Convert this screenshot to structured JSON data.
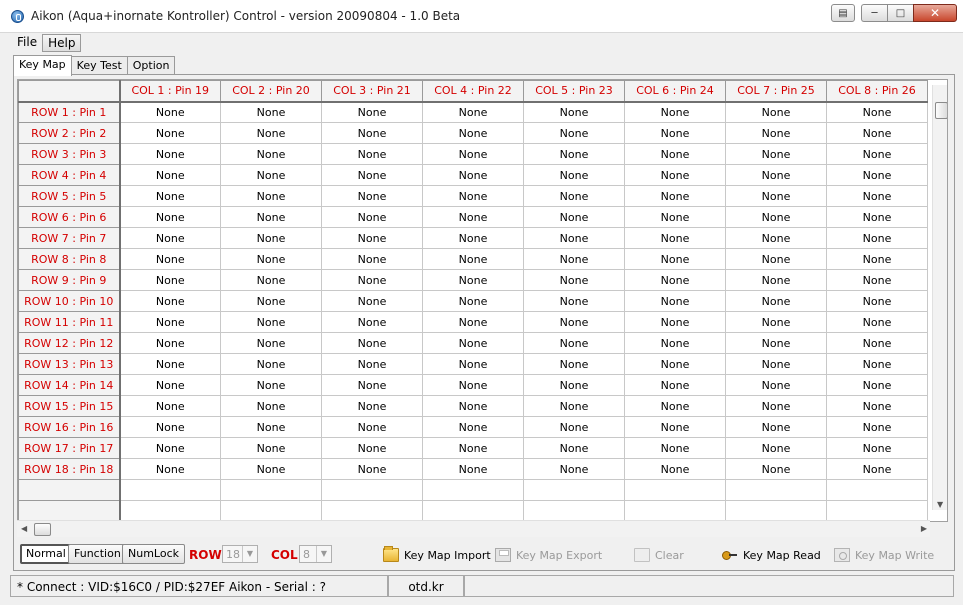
{
  "window": {
    "title": "Aikon (Aqua+inornate Kontroller) Control - version 20090804 - 1.0 Beta",
    "icons": [
      "app-icon",
      "restore-extra-icon",
      "minimize-icon",
      "maximize-icon",
      "close-icon"
    ]
  },
  "menu": {
    "items": [
      "File",
      "Help"
    ]
  },
  "tabs": [
    "Key Map",
    "Key Test",
    "Option"
  ],
  "grid": {
    "columns": [
      "COL 1 : Pin 19",
      "COL 2 : Pin 20",
      "COL 3 : Pin 21",
      "COL 4 : Pin 22",
      "COL 5 : Pin 23",
      "COL 6 : Pin 24",
      "COL 7 : Pin 25",
      "COL 8 : Pin 26"
    ],
    "rows": [
      {
        "label": "ROW 1 : Pin 1",
        "cells": [
          "None",
          "None",
          "None",
          "None",
          "None",
          "None",
          "None",
          "None"
        ]
      },
      {
        "label": "ROW 2 : Pin 2",
        "cells": [
          "None",
          "None",
          "None",
          "None",
          "None",
          "None",
          "None",
          "None"
        ]
      },
      {
        "label": "ROW 3 : Pin 3",
        "cells": [
          "None",
          "None",
          "None",
          "None",
          "None",
          "None",
          "None",
          "None"
        ]
      },
      {
        "label": "ROW 4 : Pin 4",
        "cells": [
          "None",
          "None",
          "None",
          "None",
          "None",
          "None",
          "None",
          "None"
        ]
      },
      {
        "label": "ROW 5 : Pin 5",
        "cells": [
          "None",
          "None",
          "None",
          "None",
          "None",
          "None",
          "None",
          "None"
        ]
      },
      {
        "label": "ROW 6 : Pin 6",
        "cells": [
          "None",
          "None",
          "None",
          "None",
          "None",
          "None",
          "None",
          "None"
        ]
      },
      {
        "label": "ROW 7 : Pin 7",
        "cells": [
          "None",
          "None",
          "None",
          "None",
          "None",
          "None",
          "None",
          "None"
        ]
      },
      {
        "label": "ROW 8 : Pin 8",
        "cells": [
          "None",
          "None",
          "None",
          "None",
          "None",
          "None",
          "None",
          "None"
        ]
      },
      {
        "label": "ROW 9 : Pin 9",
        "cells": [
          "None",
          "None",
          "None",
          "None",
          "None",
          "None",
          "None",
          "None"
        ]
      },
      {
        "label": "ROW 10 : Pin 10",
        "cells": [
          "None",
          "None",
          "None",
          "None",
          "None",
          "None",
          "None",
          "None"
        ]
      },
      {
        "label": "ROW 11 : Pin 11",
        "cells": [
          "None",
          "None",
          "None",
          "None",
          "None",
          "None",
          "None",
          "None"
        ]
      },
      {
        "label": "ROW 12 : Pin 12",
        "cells": [
          "None",
          "None",
          "None",
          "None",
          "None",
          "None",
          "None",
          "None"
        ]
      },
      {
        "label": "ROW 13 : Pin 13",
        "cells": [
          "None",
          "None",
          "None",
          "None",
          "None",
          "None",
          "None",
          "None"
        ]
      },
      {
        "label": "ROW 14 : Pin 14",
        "cells": [
          "None",
          "None",
          "None",
          "None",
          "None",
          "None",
          "None",
          "None"
        ]
      },
      {
        "label": "ROW 15 : Pin 15",
        "cells": [
          "None",
          "None",
          "None",
          "None",
          "None",
          "None",
          "None",
          "None"
        ]
      },
      {
        "label": "ROW 16 : Pin 16",
        "cells": [
          "None",
          "None",
          "None",
          "None",
          "None",
          "None",
          "None",
          "None"
        ]
      },
      {
        "label": "ROW 17 : Pin 17",
        "cells": [
          "None",
          "None",
          "None",
          "None",
          "None",
          "None",
          "None",
          "None"
        ]
      },
      {
        "label": "ROW 18 : Pin 18",
        "cells": [
          "None",
          "None",
          "None",
          "None",
          "None",
          "None",
          "None",
          "None"
        ]
      }
    ],
    "header_color": "#d40000"
  },
  "toolbar": {
    "mode_buttons": [
      "Normal",
      "Function",
      "NumLock"
    ],
    "row_label": "ROW",
    "row_value": "18",
    "col_label": "COL",
    "col_value": "8",
    "actions": [
      {
        "label": "Key Map Import",
        "icon": "folder-icon",
        "enabled": true
      },
      {
        "label": "Key Map Export",
        "icon": "save-icon",
        "enabled": false
      },
      {
        "label": "Clear",
        "icon": "folder-open-icon",
        "enabled": false
      },
      {
        "label": "Key Map Read",
        "icon": "key-icon",
        "enabled": true
      },
      {
        "label": "Key Map Write",
        "icon": "key-write-icon",
        "enabled": false
      }
    ]
  },
  "status": {
    "connection": "* Connect : VID:$16C0 / PID:$27EF Aikon - Serial : ?",
    "site": "otd.kr",
    "extra": ""
  }
}
